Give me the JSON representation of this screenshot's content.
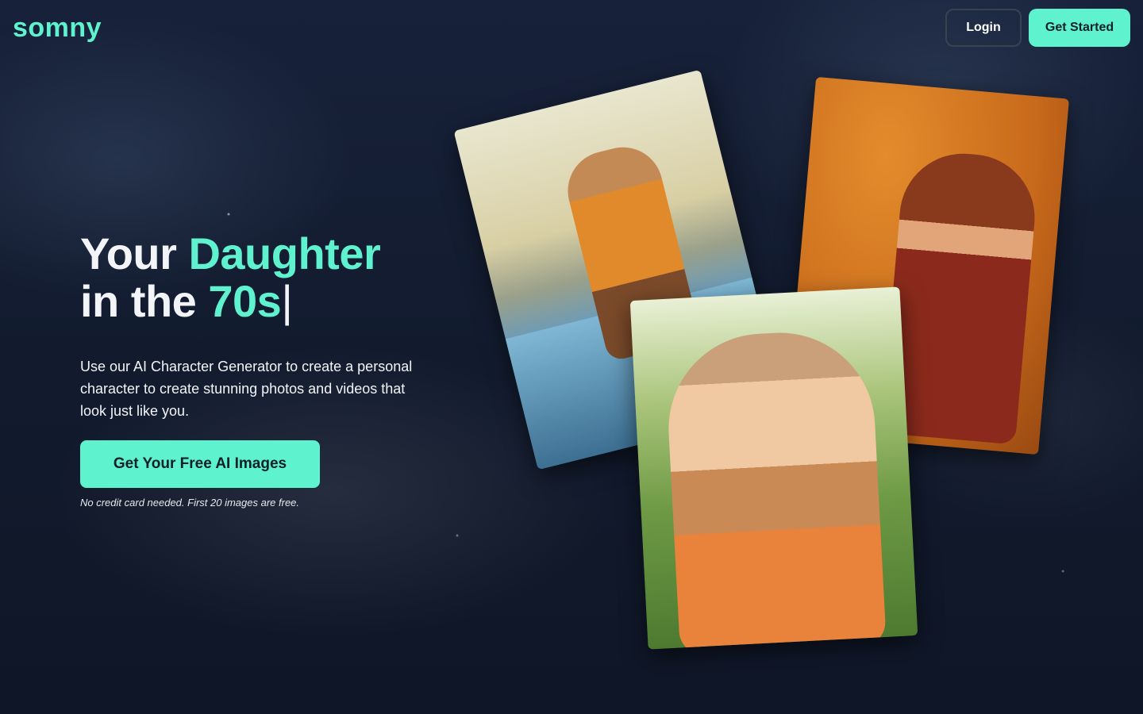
{
  "brand": {
    "logo_text": "somny",
    "accent_color": "#5ef2cf"
  },
  "header": {
    "login_label": "Login",
    "get_started_label": "Get Started"
  },
  "hero": {
    "headline_part1": "Your",
    "headline_accent1": "Daughter",
    "headline_part2": "in the",
    "headline_accent2": "70s",
    "caret": "|",
    "subtext": "Use our AI Character Generator to create a personal character to create stunning photos and videos that look just like you.",
    "cta_label": "Get Your Free AI Images",
    "note": "No credit card needed. First 20 images are free."
  },
  "gallery": {
    "photos": [
      {
        "name": "girl-on-blue-car"
      },
      {
        "name": "redhead-orange-backdrop"
      },
      {
        "name": "girl-flower-crown"
      }
    ]
  }
}
